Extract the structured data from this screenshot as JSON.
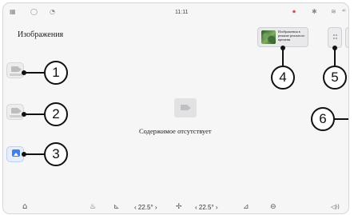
{
  "status_bar": {
    "time": "11:11",
    "left_icons": [
      {
        "name": "apps-grid-icon",
        "glyph": "▦"
      },
      {
        "name": "phone-icon",
        "glyph": "◯"
      },
      {
        "name": "timer-icon",
        "glyph": "◔"
      }
    ],
    "right_icons": [
      {
        "name": "record-icon",
        "glyph": "⏺"
      },
      {
        "name": "bluetooth-icon",
        "glyph": "✱"
      },
      {
        "name": "wifi-icon",
        "glyph": "≋"
      },
      {
        "name": "signal-icon",
        "glyph": "⁴ˡ"
      }
    ]
  },
  "page": {
    "title": "Изображения",
    "empty_text": "Содержимое отсутствует"
  },
  "thumbnail_card": {
    "text": "Изображения в режиме реального времени"
  },
  "callouts": [
    "1",
    "2",
    "3",
    "4",
    "5",
    "6"
  ],
  "climate_bar": {
    "home_icon": "⌂",
    "front_defrost_icon": "♨",
    "seat_left_icon": "⊾",
    "temp_left": "‹ 22.5° ›",
    "fan_icon": "✢",
    "temp_right": "‹ 22.5° ›",
    "seat_right_icon": "⊿",
    "car_icon": "⊖",
    "volume_icon": "◁))"
  },
  "colors": {
    "accent_blue": "#3f7fe6",
    "background": "#f6f6f7",
    "callout_ink": "#111111"
  }
}
